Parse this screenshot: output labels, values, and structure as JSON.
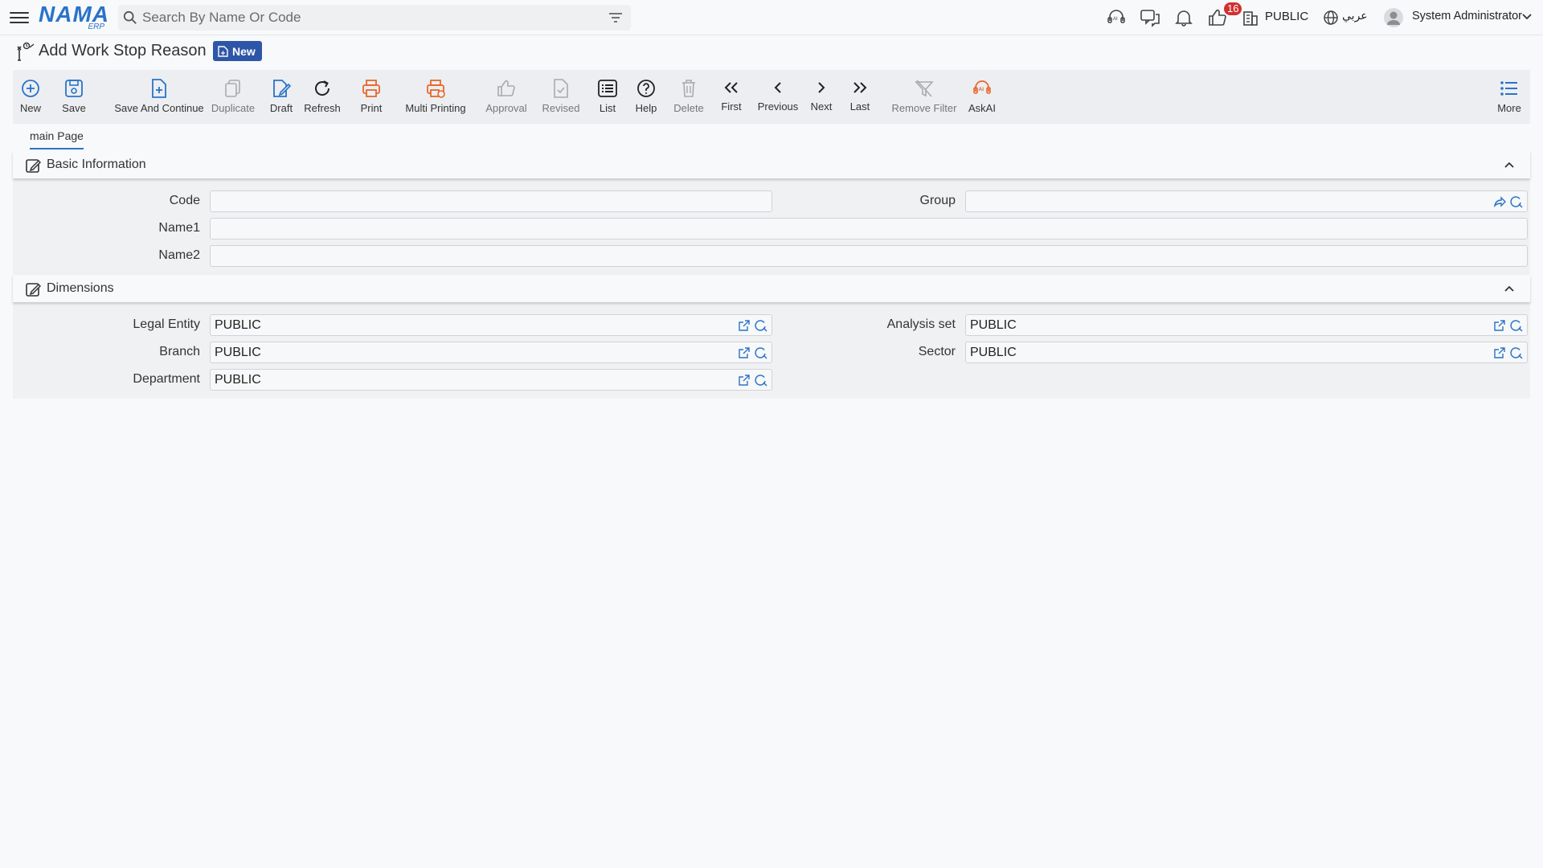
{
  "topbar": {
    "logo_main": "NAMA",
    "logo_sub": "ERP",
    "search_placeholder": "Search By Name Or Code",
    "notification_count": "16",
    "company": "PUBLIC",
    "language": "عربي",
    "user": "System Administrator"
  },
  "page": {
    "title": "Add Work Stop Reason",
    "status": "New"
  },
  "toolbar": {
    "new": "New",
    "save": "Save",
    "save_continue": "Save And Continue",
    "duplicate": "Duplicate",
    "draft": "Draft",
    "refresh": "Refresh",
    "print": "Print",
    "multi_printing": "Multi Printing",
    "approval": "Approval",
    "revised": "Revised",
    "list": "List",
    "help": "Help",
    "delete": "Delete",
    "first": "First",
    "previous": "Previous",
    "next": "Next",
    "last": "Last",
    "remove_filter": "Remove Filter",
    "ask_ai": "AskAI",
    "more": "More"
  },
  "tabs": [
    {
      "label": "main Page"
    }
  ],
  "basic_info": {
    "title": "Basic Information",
    "code_label": "Code",
    "code_value": "",
    "group_label": "Group",
    "group_value": "",
    "name1_label": "Name1",
    "name1_value": "",
    "name2_label": "Name2",
    "name2_value": ""
  },
  "dimensions": {
    "title": "Dimensions",
    "legal_entity_label": "Legal Entity",
    "legal_entity_value": "PUBLIC",
    "analysis_set_label": "Analysis set",
    "analysis_set_value": "PUBLIC",
    "branch_label": "Branch",
    "branch_value": "PUBLIC",
    "sector_label": "Sector",
    "sector_value": "PUBLIC",
    "department_label": "Department",
    "department_value": "PUBLIC"
  },
  "colors": {
    "accent": "#2a73c9",
    "orange": "#e8662a",
    "badge_red": "#d32f2f",
    "status_badge": "#2e56a8"
  }
}
